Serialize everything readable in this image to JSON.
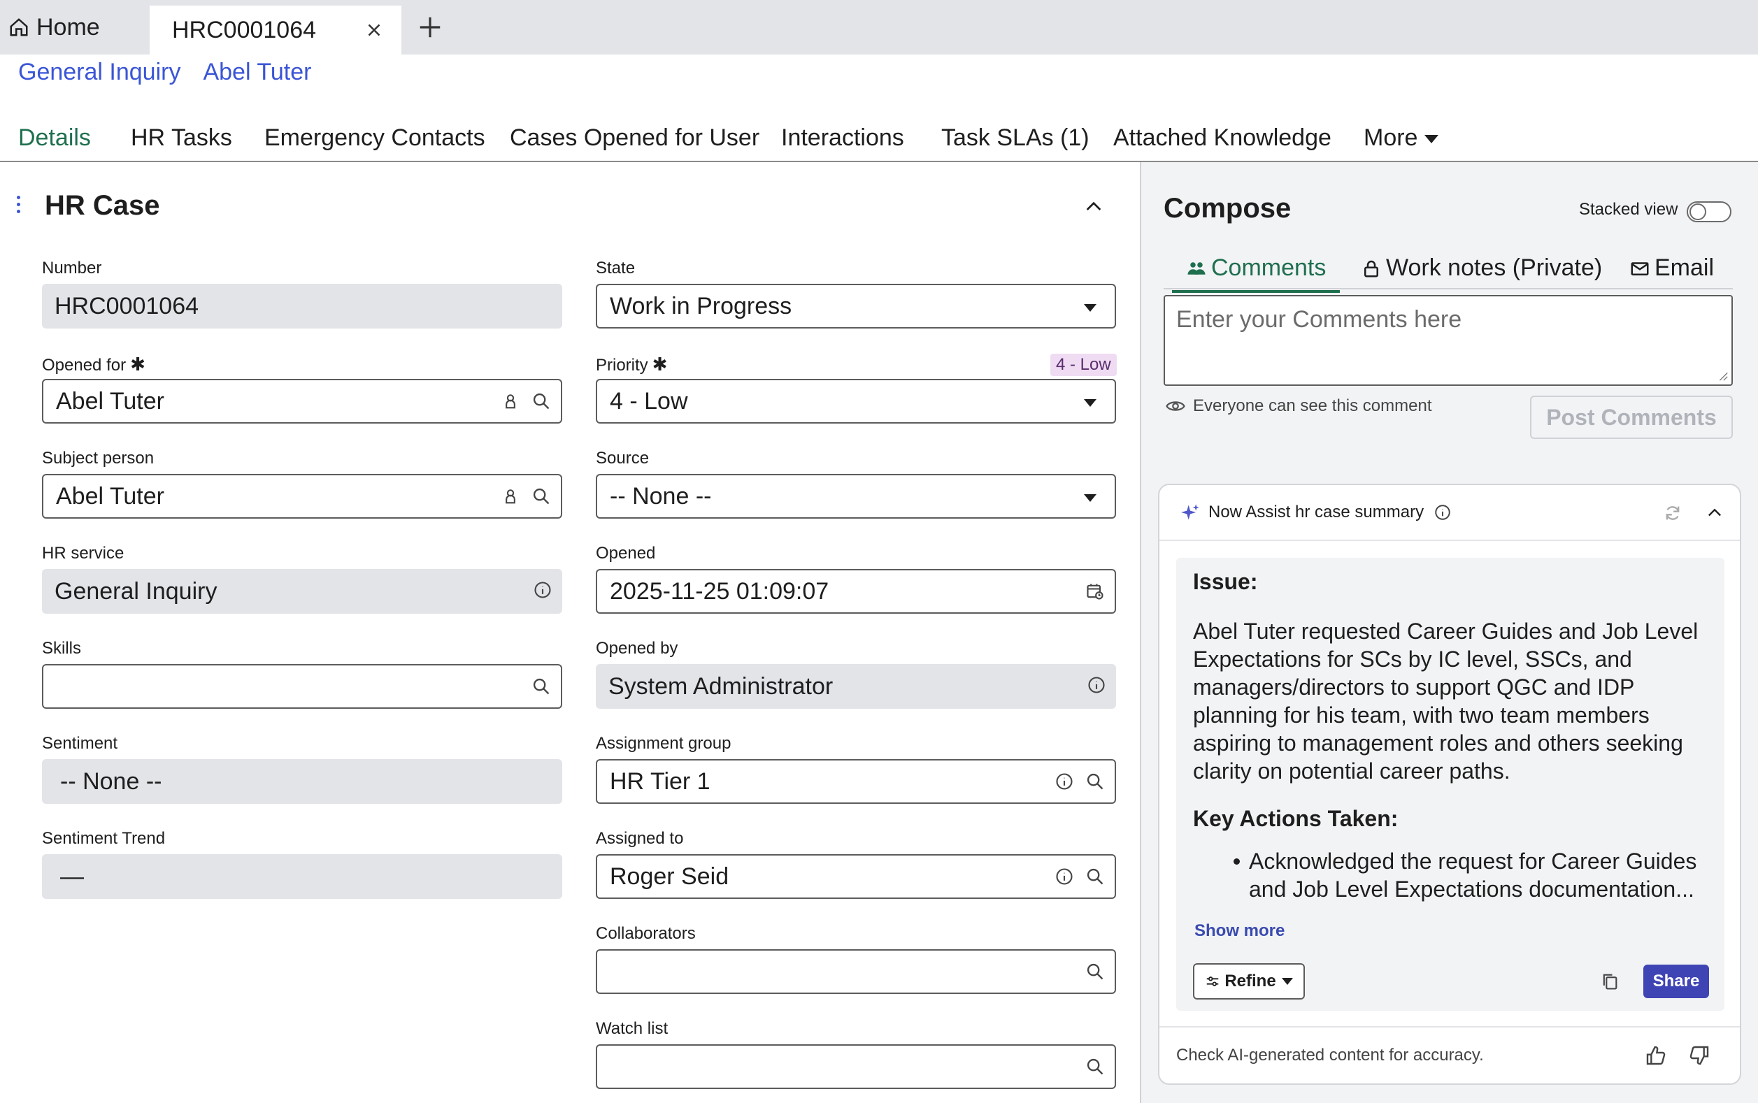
{
  "browser_tabs": {
    "home_label": "Home",
    "active_label": "HRC0001064"
  },
  "breadcrumb": [
    "General Inquiry",
    "Abel Tuter"
  ],
  "nav_tabs": {
    "details": "Details",
    "hr_tasks": "HR Tasks",
    "emergency_contacts": "Emergency Contacts",
    "cases_opened": "Cases Opened for User",
    "interactions": "Interactions",
    "task_slas": "Task SLAs (1)",
    "attached_knowledge": "Attached Knowledge",
    "more": "More"
  },
  "form": {
    "title": "HR Case",
    "number": {
      "label": "Number",
      "value": "HRC0001064"
    },
    "opened_for": {
      "label": "Opened for",
      "value": "Abel Tuter"
    },
    "subject_person": {
      "label": "Subject person",
      "value": "Abel Tuter"
    },
    "hr_service": {
      "label": "HR service",
      "value": "General Inquiry"
    },
    "skills": {
      "label": "Skills",
      "value": ""
    },
    "sentiment": {
      "label": "Sentiment",
      "value": "-- None --"
    },
    "sentiment_trend": {
      "label": "Sentiment Trend",
      "value": "—"
    },
    "state": {
      "label": "State",
      "value": "Work in Progress"
    },
    "priority": {
      "label": "Priority",
      "value": "4 - Low",
      "badge": "4 - Low",
      "badge_color": "#efdcf3"
    },
    "source": {
      "label": "Source",
      "value": "-- None --"
    },
    "opened": {
      "label": "Opened",
      "value": "2025-11-25 01:09:07"
    },
    "opened_by": {
      "label": "Opened by",
      "value": "System Administrator"
    },
    "assignment_group": {
      "label": "Assignment group",
      "value": "HR Tier 1"
    },
    "assigned_to": {
      "label": "Assigned to",
      "value": "Roger Seid"
    },
    "collaborators": {
      "label": "Collaborators",
      "value": ""
    },
    "watch_list": {
      "label": "Watch list",
      "value": ""
    }
  },
  "compose": {
    "title": "Compose",
    "stacked_view_label": "Stacked view",
    "stacked_view_on": false,
    "tabs": {
      "comments": "Comments",
      "work_notes": "Work notes (Private)",
      "email": "Email"
    },
    "comment_placeholder": "Enter your Comments here",
    "visibility_note": "Everyone can see this comment",
    "post_button": "Post Comments"
  },
  "now_assist": {
    "header": "Now Assist hr case summary",
    "issue_heading": "Issue:",
    "issue_text": "Abel Tuter requested Career Guides and Job Level Expectations for SCs by IC level, SSCs, and managers/directors to support QGC and IDP planning for his team, with two team members aspiring to management roles and others seeking clarity on potential career paths.",
    "actions_heading": "Key Actions Taken:",
    "actions": [
      "Acknowledged the request for Career Guides and Job Level Expectations documentation..."
    ],
    "show_more": "Show more",
    "refine_label": "Refine",
    "share_label": "Share",
    "footer_note": "Check AI-generated content for accuracy."
  },
  "colors": {
    "accent_green": "#1f6f4f",
    "link_blue": "#3a55d6",
    "share_button": "#3f44b5",
    "readonly_bg": "#e3e4e8"
  }
}
